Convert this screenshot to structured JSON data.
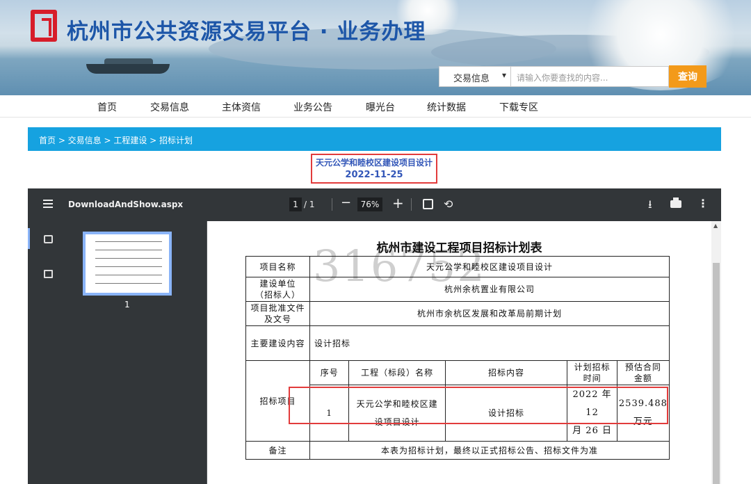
{
  "site": {
    "title": "杭州市公共资源交易平台 · 业务办理"
  },
  "search": {
    "category": "交易信息",
    "placeholder": "请输入你要查找的内容...",
    "button": "查询"
  },
  "nav": [
    "首页",
    "交易信息",
    "主体资信",
    "业务公告",
    "曝光台",
    "统计数据",
    "下载专区"
  ],
  "breadcrumb": "首页 > 交易信息 > 工程建设 > 招标计划",
  "notice": {
    "title": "天元公学和睦校区建设项目设计",
    "date": "2022-11-25"
  },
  "viewer": {
    "filename": "DownloadAndShow.aspx",
    "current_page": "1",
    "total_pages": "/ 1",
    "zoom": "76%",
    "thumb_page": "1"
  },
  "document": {
    "title": "杭州市建设工程项目招标计划表",
    "watermark": "316752",
    "rows": {
      "project_name_label": "项目名称",
      "project_name": "天元公学和睦校区建设项目设计",
      "builder_label_1": "建设单位",
      "builder_label_2": "（招标人）",
      "builder": "杭州余杭置业有限公司",
      "approval_label_1": "项目批准文件",
      "approval_label_2": "及文号",
      "approval": "杭州市余杭区发展和改革局前期计划",
      "content_label": "主要建设内容",
      "content": "设计招标",
      "bidding_label": "招标项目",
      "remark_label": "备注",
      "remark": "本表为招标计划，最终以正式招标公告、招标文件为准"
    },
    "sub_headers": {
      "no": "序号",
      "name": "工程（标段）名称",
      "content": "招标内容",
      "time_1": "计划招标",
      "time_2": "时间",
      "amount_1": "预估合同",
      "amount_2": "金额"
    },
    "item": {
      "no": "1",
      "name_1": "天元公学和睦校区建",
      "name_2": "设项目设计",
      "content": "设计招标",
      "time_1": "2022 年 12",
      "time_2": "月 26 日",
      "amount_1": "2539.488",
      "amount_2": "万元"
    }
  }
}
